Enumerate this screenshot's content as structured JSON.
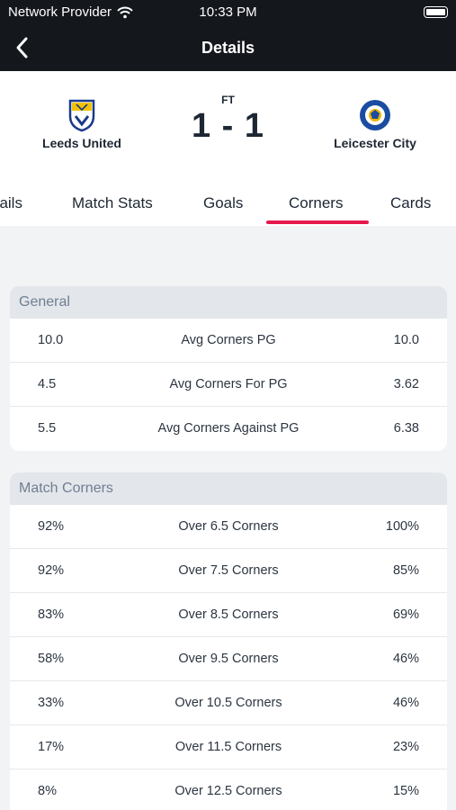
{
  "status_bar": {
    "carrier": "Network Provider",
    "time": "10:33 PM",
    "wifi_icon": "wifi-icon",
    "battery_icon": "battery-icon"
  },
  "nav": {
    "title": "Details",
    "back_icon": "chevron-left-icon"
  },
  "match": {
    "status": "FT",
    "score": "1 - 1",
    "home_team": "Leeds United",
    "away_team": "Leicester City",
    "home_crest_icon": "leeds-crest-icon",
    "away_crest_icon": "leicester-crest-icon"
  },
  "tabs": [
    {
      "label": "Details"
    },
    {
      "label": "Match Stats"
    },
    {
      "label": "Goals"
    },
    {
      "label": "Corners",
      "active": true
    },
    {
      "label": "Cards"
    }
  ],
  "colors": {
    "accent": "#e6194b",
    "header_bg": "#14171c",
    "section_header_bg": "#e3e6ea"
  },
  "sections": [
    {
      "title": "General",
      "rows": [
        {
          "home": "10.0",
          "label": "Avg Corners PG",
          "away": "10.0"
        },
        {
          "home": "4.5",
          "label": "Avg Corners For PG",
          "away": "3.62"
        },
        {
          "home": "5.5",
          "label": "Avg Corners Against PG",
          "away": "6.38"
        }
      ]
    },
    {
      "title": "Match Corners",
      "rows": [
        {
          "home": "92%",
          "label": "Over 6.5 Corners",
          "away": "100%"
        },
        {
          "home": "92%",
          "label": "Over 7.5 Corners",
          "away": "85%"
        },
        {
          "home": "83%",
          "label": "Over 8.5 Corners",
          "away": "69%"
        },
        {
          "home": "58%",
          "label": "Over 9.5 Corners",
          "away": "46%"
        },
        {
          "home": "33%",
          "label": "Over 10.5 Corners",
          "away": "46%"
        },
        {
          "home": "17%",
          "label": "Over 11.5 Corners",
          "away": "23%"
        },
        {
          "home": "8%",
          "label": "Over 12.5 Corners",
          "away": "15%"
        }
      ]
    }
  ]
}
